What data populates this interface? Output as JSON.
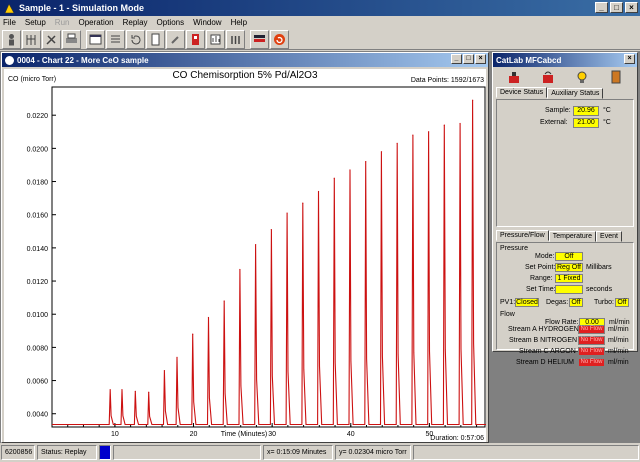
{
  "app": {
    "title": "Sample - 1 - Simulation Mode"
  },
  "menu": [
    "File",
    "Setup",
    "Run",
    "Operation",
    "Replay",
    "Options",
    "Window",
    "Help"
  ],
  "toolbar_icons": [
    "person-icon",
    "tree-icon",
    "tools-icon",
    "print-icon",
    "window-icon",
    "list-icon",
    "refresh-icon",
    "page-icon",
    "wrench-icon",
    "red-device-icon",
    "gauge-icon",
    "bars-icon",
    "flag-icon",
    "cycle-icon"
  ],
  "chart_window": {
    "title": "0004 - Chart 22 - More CeO sample",
    "y_unit": "CO (micro Torr)",
    "data_points": "Data Points: 1592/1673",
    "duration": "Duration: 0:57:06"
  },
  "chart_data": {
    "type": "line",
    "title": "CO Chemisorption 5% Pd/Al2O3",
    "xlabel": "Time (Minutes)",
    "ylabel": "CO (micro Torr)",
    "xlim": [
      2,
      57.2
    ],
    "ylim": [
      0.0032,
      0.0237
    ],
    "x_ticks": [
      10,
      20,
      30,
      40,
      50
    ],
    "y_ticks": [
      0.004,
      0.006,
      0.008,
      0.01,
      0.012,
      0.014,
      0.016,
      0.018,
      0.02,
      0.022
    ],
    "y_tick_labels": [
      "0.0040",
      "0.0060",
      "0.0080",
      "0.0100",
      "0.0120",
      "0.0140",
      "0.0160",
      "0.0180",
      "0.0200",
      "0.0220"
    ],
    "baseline": 0.00335,
    "grid": false,
    "series": [
      {
        "color": "#cc1111",
        "peaks": [
          {
            "x": 9.4,
            "y": 0.00545
          },
          {
            "x": 10.9,
            "y": 0.00545
          },
          {
            "x": 12.6,
            "y": 0.00535
          },
          {
            "x": 14.3,
            "y": 0.0053
          },
          {
            "x": 16.3,
            "y": 0.0066
          },
          {
            "x": 17.9,
            "y": 0.0074
          },
          {
            "x": 19.9,
            "y": 0.0088
          },
          {
            "x": 21.9,
            "y": 0.0098
          },
          {
            "x": 23.9,
            "y": 0.0108
          },
          {
            "x": 25.9,
            "y": 0.0127
          },
          {
            "x": 27.9,
            "y": 0.0142
          },
          {
            "x": 29.9,
            "y": 0.0151
          },
          {
            "x": 31.9,
            "y": 0.0161
          },
          {
            "x": 33.9,
            "y": 0.0167
          },
          {
            "x": 35.9,
            "y": 0.0174
          },
          {
            "x": 37.9,
            "y": 0.0182
          },
          {
            "x": 39.9,
            "y": 0.0187
          },
          {
            "x": 41.9,
            "y": 0.0192
          },
          {
            "x": 43.9,
            "y": 0.0198
          },
          {
            "x": 45.9,
            "y": 0.0203
          },
          {
            "x": 47.9,
            "y": 0.0208
          },
          {
            "x": 49.9,
            "y": 0.021
          },
          {
            "x": 51.9,
            "y": 0.0214
          },
          {
            "x": 53.9,
            "y": 0.0215
          },
          {
            "x": 55.5,
            "y": 0.0229
          }
        ]
      }
    ]
  },
  "side_window": {
    "title": "CatLab MFCabcd",
    "icons": [
      "valve-icon",
      "heater-icon",
      "bulb-icon",
      "door-icon"
    ],
    "tabs_top": [
      "Device Status",
      "Auxiliary Status"
    ],
    "sample_label": "Sample:",
    "sample_value": "20.96",
    "sample_unit": "°C",
    "external_label": "External:",
    "external_value": "21.00",
    "external_unit": "°C",
    "tabs_bottom": [
      "Pressure/Flow",
      "Temperature",
      "Event"
    ],
    "pressure_group": "Pressure",
    "mode_label": "Mode:",
    "mode_value": "Off",
    "setpoint_label": "Set Point:",
    "setpoint_value": "Reg Off",
    "setpoint_unit": "Millibars",
    "range_label": "Range:",
    "range_value": "1 Fixed",
    "settime_label": "Set Time:",
    "settime_value": "",
    "settime_unit": "seconds",
    "pv1_label": "PV1:",
    "pv1_value": "Closed",
    "degas_label": "Degas:",
    "degas_value": "Off",
    "turbo_label": "Turbo:",
    "turbo_value": "Off",
    "flow_group": "Flow",
    "flowrate_label": "Flow Rate:",
    "flowrate_value": "0.00",
    "flowrate_unit": "ml/min",
    "streams": [
      {
        "label": "Stream A HYDROGEN",
        "value": "No Flow",
        "unit": "ml/min"
      },
      {
        "label": "Stream B NITROGEN",
        "value": "No Flow",
        "unit": "ml/min"
      },
      {
        "label": "Stream C ARGON",
        "value": "No Flow",
        "unit": "ml/min"
      },
      {
        "label": "Stream D HELIUM",
        "value": "No Flow",
        "unit": "ml/min"
      }
    ]
  },
  "status_bar": {
    "code": "6200856",
    "status": "Status: Replay",
    "x_readout": "x= 0:15:09 Minutes",
    "y_readout": "y= 0.02304 micro Torr"
  }
}
